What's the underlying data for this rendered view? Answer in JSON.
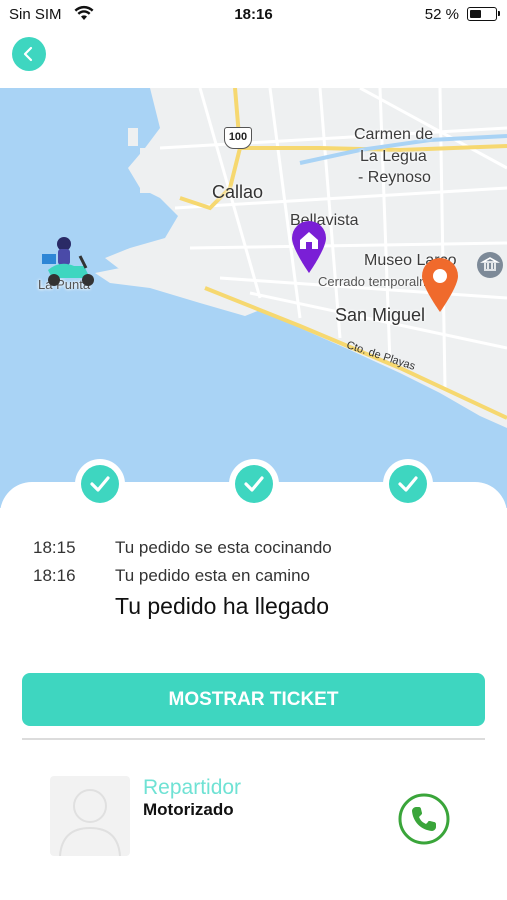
{
  "status_bar": {
    "carrier": "Sin SIM",
    "time": "18:16",
    "battery_percent": "52 %",
    "battery_level": 0.52
  },
  "map": {
    "labels": {
      "callao": "Callao",
      "carmen_line1": "Carmen de",
      "carmen_line2": "La Legua",
      "carmen_line3": "- Reynoso",
      "bellavista": "Bellavista",
      "museo": "Museo Larco",
      "cerrado": "Cerrado temporalmente",
      "san_miguel": "San Miguel",
      "la_punta": "La Punta",
      "playas": "Cto. de Playas",
      "highway": "100"
    },
    "colors": {
      "water": "#a9d3f5",
      "land": "#eef0f1",
      "home_marker": "#7a1fd6",
      "destination_marker": "#f06a2c"
    },
    "icons": [
      "scooter-rider-icon",
      "home-location-pin-icon",
      "destination-pin-icon",
      "museum-icon"
    ]
  },
  "progress": {
    "steps_completed": 3,
    "steps_total": 3
  },
  "timeline": [
    {
      "time": "18:15",
      "text": "Tu pedido se esta cocinando"
    },
    {
      "time": "18:16",
      "text": "Tu pedido esta en camino"
    }
  ],
  "final_status": "Tu pedido ha llegado",
  "ticket_button_label": "MOSTRAR TICKET",
  "courier": {
    "role": "Repartidor",
    "vehicle": "Motorizado"
  },
  "colors": {
    "accent": "#3ed6c0",
    "call_green": "#3aa53a"
  }
}
